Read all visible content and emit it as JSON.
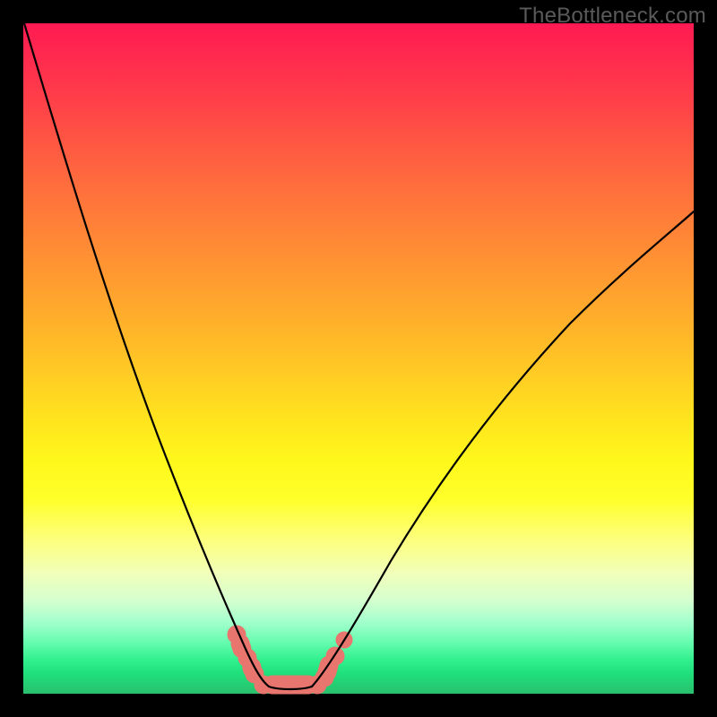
{
  "watermark": {
    "text": "TheBottleneck.com"
  },
  "chart_data": {
    "type": "line",
    "title": "",
    "xlabel": "",
    "ylabel": "",
    "xlim": [
      0,
      100
    ],
    "ylim": [
      0,
      100
    ],
    "grid": false,
    "legend": false,
    "series": [
      {
        "name": "left-branch",
        "x": [
          0,
          5,
          10,
          15,
          20,
          25,
          28,
          30,
          32,
          34,
          36
        ],
        "y": [
          100,
          83,
          66,
          49,
          33,
          17,
          10,
          6,
          3,
          2,
          1
        ]
      },
      {
        "name": "right-branch",
        "x": [
          43,
          46,
          50,
          55,
          60,
          65,
          70,
          75,
          80,
          85,
          90,
          95,
          100
        ],
        "y": [
          1,
          4,
          9,
          18,
          27,
          35,
          42,
          49,
          55,
          60,
          65,
          69,
          73
        ]
      },
      {
        "name": "valley-floor",
        "x": [
          36,
          38,
          40,
          42,
          43
        ],
        "y": [
          1,
          0.5,
          0.5,
          0.5,
          1
        ]
      }
    ],
    "annotations": [
      {
        "name": "worm-left",
        "x_range": [
          31.5,
          35
        ],
        "y_range": [
          2,
          8
        ]
      },
      {
        "name": "worm-floor",
        "x_range": [
          35,
          44
        ],
        "y_range": [
          0,
          2
        ]
      },
      {
        "name": "worm-right",
        "x_range": [
          44,
          47
        ],
        "y_range": [
          2,
          7
        ]
      }
    ],
    "colors": {
      "curve": "#000000",
      "worm": "#e8766e",
      "gradient_top": "#ff1a52",
      "gradient_bottom": "#2abf6d"
    }
  }
}
